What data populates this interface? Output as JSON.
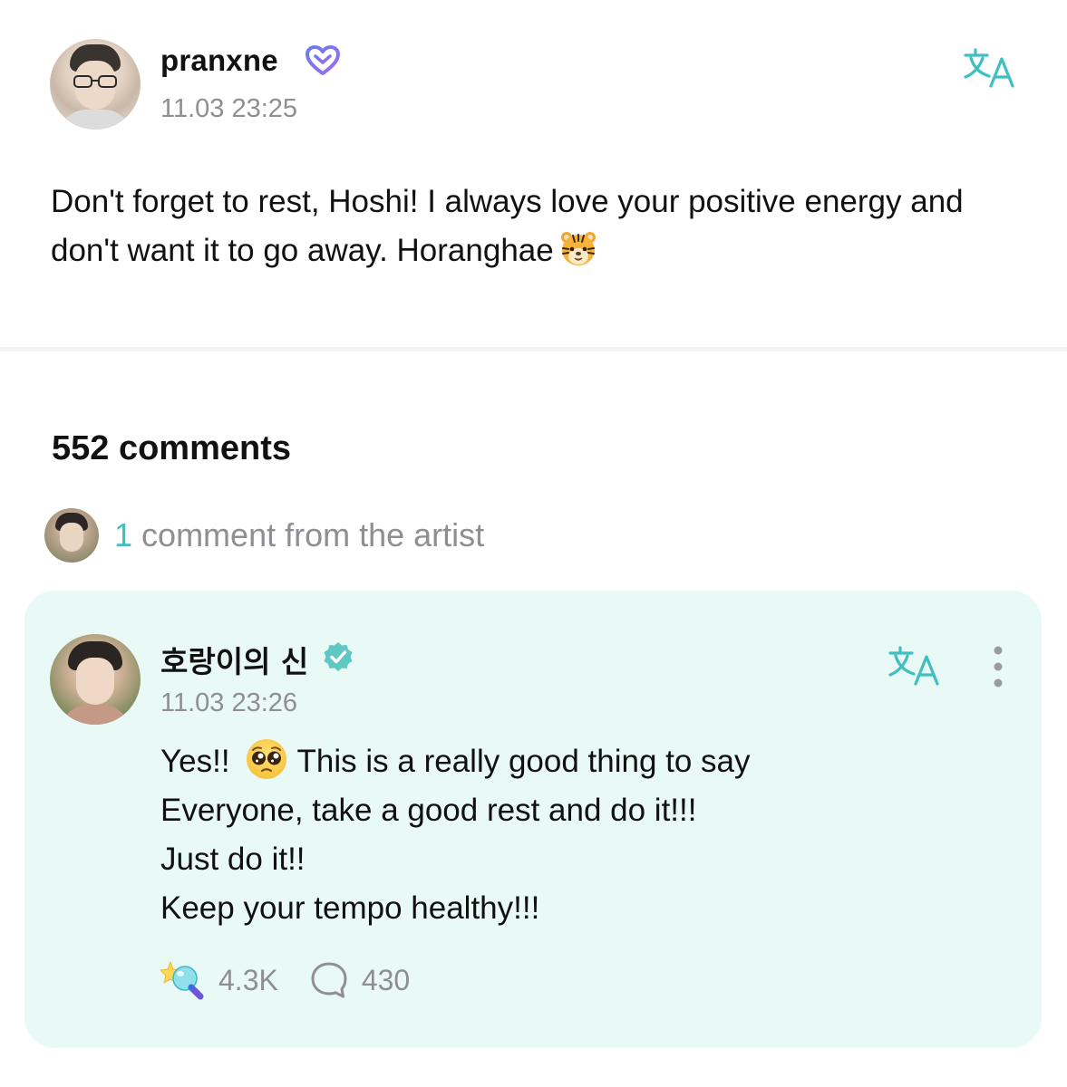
{
  "post": {
    "author": "pranxne",
    "timestamp": "11.03 23:25",
    "body": "Don't forget to rest, Hoshi! I always love your positive energy and don't want it to go away. Horanghae",
    "emoji_icon": "tiger-face-icon",
    "translate_icon": "translate-icon",
    "membership_icon": "heart-membership-icon"
  },
  "comments": {
    "count_label": "552 comments",
    "artist_summary": {
      "count": "1",
      "label": "comment from the artist"
    },
    "artist_comment": {
      "author": "호랑이의 신",
      "verified_icon": "verified-badge-icon",
      "timestamp": "11.03 23:26",
      "lines": [
        "Yes!!",
        "This is a really good thing to say",
        "Everyone, take a good rest and do it!!!",
        "Just do it!!",
        "Keep your tempo healthy!!!"
      ],
      "emoji_icon": "pleading-face-icon",
      "likes": "4.3K",
      "replies": "430"
    }
  },
  "colors": {
    "accent": "#3fc0c0",
    "card_background": "#e8f9f6",
    "muted_text": "#8e8e93",
    "primary_text": "#111111"
  }
}
